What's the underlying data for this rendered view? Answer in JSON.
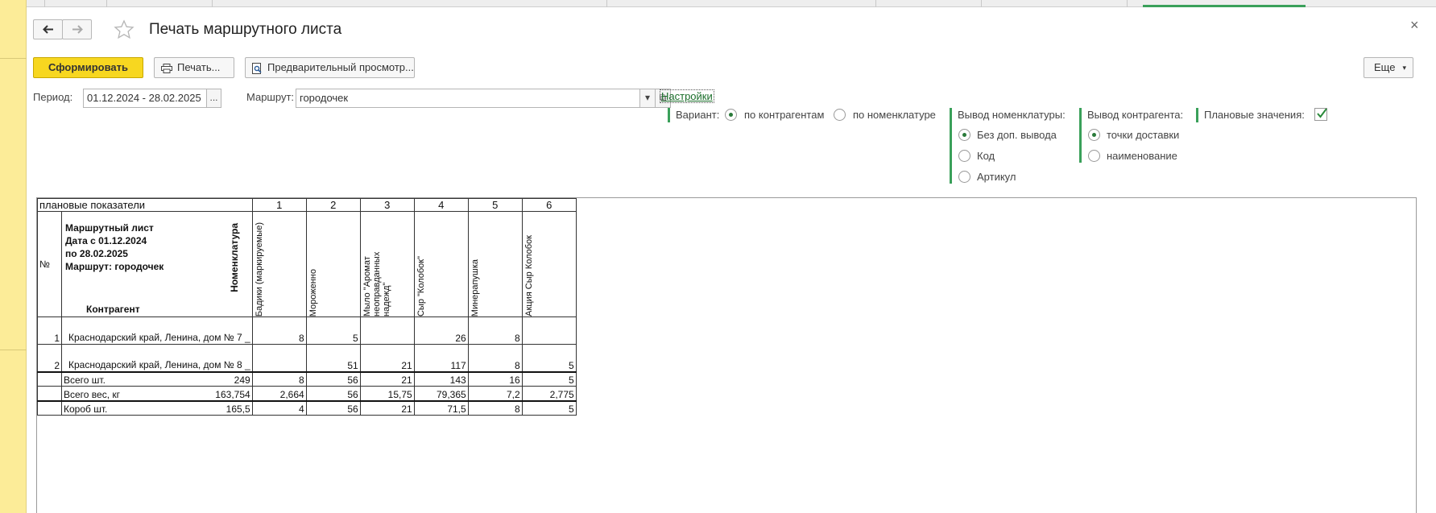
{
  "window": {
    "title": "Печать маршрутного листа",
    "close_glyph": "×"
  },
  "toolbar": {
    "generate_label": "Сформировать",
    "print_label": "Печать...",
    "preview_label": "Предварительный просмотр...",
    "more_label": "Еще",
    "more_arrow": "▾"
  },
  "filters": {
    "period_label": "Период:",
    "period_value": "01.12.2024 - 28.02.2025",
    "period_btn": "...",
    "route_label": "Маршрут:",
    "route_value": "городочек",
    "dropdown_glyph": "▾",
    "open_glyph": "⧉",
    "settings_link": "Настройки"
  },
  "options": {
    "variant_label": "Вариант:",
    "variant_options": [
      "по контрагентам",
      "по номенклатуре"
    ],
    "variant_selected": 0,
    "nomen_output_label": "Вывод номенклатуры:",
    "nomen_options": [
      "Без доп. вывода",
      "Код",
      "Артикул"
    ],
    "nomen_selected": 0,
    "contr_output_label": "Вывод контрагента:",
    "contr_options": [
      "точки доставки",
      "наименование"
    ],
    "contr_selected": 0,
    "planned_label": "Плановые значения:",
    "planned_checked": true
  },
  "report": {
    "plan_row_label": "плановые показатели",
    "col_numbers": [
      "1",
      "2",
      "3",
      "4",
      "5",
      "6"
    ],
    "no_header": "№",
    "header_lines": [
      "Маршрутный лист",
      "Дата с 01.12.2024",
      "по 28.02.2025",
      "Маршрут: городочек"
    ],
    "counterparty_header": "Контрагент",
    "nomenclature_header": "Номенклатура",
    "products": [
      "Бадики (маркируемые)",
      "Мороженно",
      "Мыло \"Аромат неоправданных надежд\"",
      "Сыр \"Колобок\"",
      "Минерапушка",
      "Акция Сыр Колобок"
    ],
    "rows": [
      {
        "no": "1",
        "name": "Краснодарский край, Ленина, дом № 7 _",
        "values": [
          "8",
          "5",
          "",
          "26",
          "8",
          ""
        ]
      },
      {
        "no": "2",
        "name": "Краснодарский край, Ленина, дом № 8 _",
        "values": [
          "",
          "51",
          "21",
          "117",
          "8",
          "5"
        ]
      }
    ],
    "totals": [
      {
        "label": "Всего шт.",
        "total": "249",
        "values": [
          "8",
          "56",
          "21",
          "143",
          "16",
          "5"
        ]
      },
      {
        "label": "Всего вес, кг",
        "total": "163,754",
        "values": [
          "2,664",
          "56",
          "15,75",
          "79,365",
          "7,2",
          "2,775"
        ]
      },
      {
        "label": "Короб шт.",
        "total": "165,5",
        "values": [
          "4",
          "56",
          "21",
          "71,5",
          "8",
          "5"
        ]
      }
    ]
  }
}
